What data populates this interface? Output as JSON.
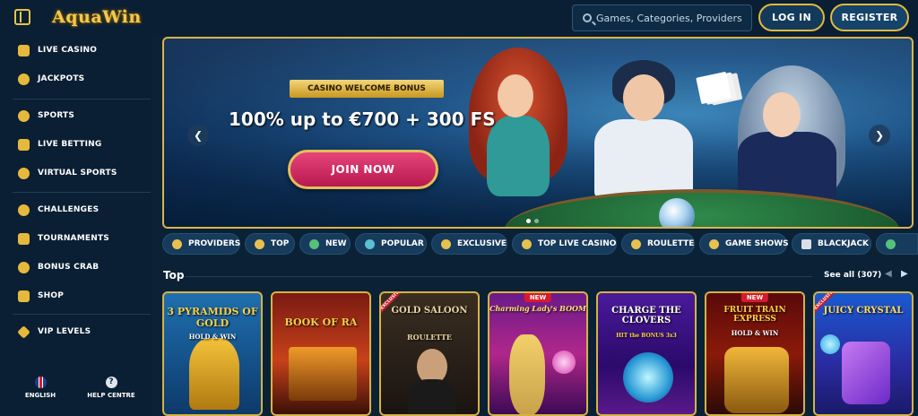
{
  "header": {
    "logo": "AquaWin",
    "search_placeholder": "Games, Categories, Providers",
    "login_label": "LOG IN",
    "register_label": "REGISTER"
  },
  "sidebar": {
    "items": [
      {
        "label": "LIVE CASINO",
        "icon": "cards-icon"
      },
      {
        "label": "JACKPOTS",
        "icon": "clover-icon"
      },
      {
        "label": "SPORTS",
        "icon": "ball-icon"
      },
      {
        "label": "LIVE BETTING",
        "icon": "live-icon"
      },
      {
        "label": "VIRTUAL SPORTS",
        "icon": "virtual-icon"
      },
      {
        "label": "CHALLENGES",
        "icon": "medal-icon"
      },
      {
        "label": "TOURNAMENTS",
        "icon": "trophy-icon"
      },
      {
        "label": "BONUS CRAB",
        "icon": "crab-icon"
      },
      {
        "label": "SHOP",
        "icon": "basket-icon"
      },
      {
        "label": "VIP LEVELS",
        "icon": "diamond-icon"
      }
    ],
    "language_label": "ENGLISH",
    "help_label": "HELP CENTRE"
  },
  "banner": {
    "ribbon": "CASINO WELCOME BONUS",
    "headline": "100% up to €700 + 300 FS",
    "cta": "JOIN NOW"
  },
  "tabs": [
    "PROVIDERS",
    "TOP",
    "NEW",
    "POPULAR",
    "EXCLUSIVE",
    "TOP LIVE CASINO",
    "ROULETTE",
    "GAME SHOWS",
    "BLACKJACK"
  ],
  "section": {
    "title": "Top",
    "see_all": "See all (307)"
  },
  "games": [
    {
      "title": "3 PYRAMIDS OF GOLD",
      "subtitle": "HOLD & WIN",
      "badge": "",
      "corner": ""
    },
    {
      "title": "BOOK OF RA",
      "subtitle": "",
      "badge": "",
      "corner": ""
    },
    {
      "title": "GOLD SALOON",
      "subtitle": "ROULETTE",
      "badge": "",
      "corner": "EXCLUSIVE"
    },
    {
      "title": "Charming Lady's BOOM",
      "subtitle": "",
      "badge": "NEW",
      "corner": ""
    },
    {
      "title": "CHARGE THE CLOVERS",
      "subtitle": "HIT the BONUS 3x3",
      "badge": "",
      "corner": ""
    },
    {
      "title": "FRUIT TRAIN EXPRESS",
      "subtitle": "HOLD & WIN",
      "badge": "NEW",
      "corner": ""
    },
    {
      "title": "JUICY CRYSTAL",
      "subtitle": "",
      "badge": "",
      "corner": "EXCLUSIVE"
    }
  ]
}
